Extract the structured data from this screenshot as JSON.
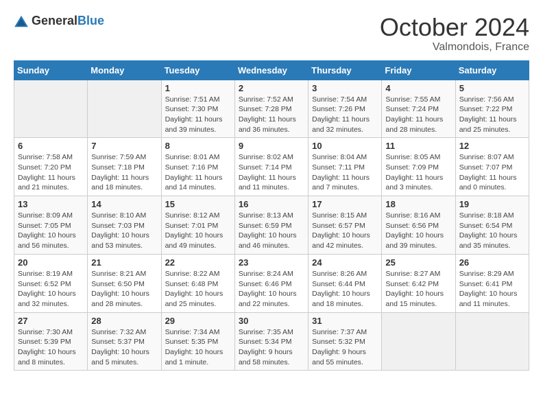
{
  "header": {
    "logo_general": "General",
    "logo_blue": "Blue",
    "month": "October 2024",
    "location": "Valmondois, France"
  },
  "days_of_week": [
    "Sunday",
    "Monday",
    "Tuesday",
    "Wednesday",
    "Thursday",
    "Friday",
    "Saturday"
  ],
  "weeks": [
    [
      {
        "day": "",
        "info": ""
      },
      {
        "day": "",
        "info": ""
      },
      {
        "day": "1",
        "info": "Sunrise: 7:51 AM\nSunset: 7:30 PM\nDaylight: 11 hours and 39 minutes."
      },
      {
        "day": "2",
        "info": "Sunrise: 7:52 AM\nSunset: 7:28 PM\nDaylight: 11 hours and 36 minutes."
      },
      {
        "day": "3",
        "info": "Sunrise: 7:54 AM\nSunset: 7:26 PM\nDaylight: 11 hours and 32 minutes."
      },
      {
        "day": "4",
        "info": "Sunrise: 7:55 AM\nSunset: 7:24 PM\nDaylight: 11 hours and 28 minutes."
      },
      {
        "day": "5",
        "info": "Sunrise: 7:56 AM\nSunset: 7:22 PM\nDaylight: 11 hours and 25 minutes."
      }
    ],
    [
      {
        "day": "6",
        "info": "Sunrise: 7:58 AM\nSunset: 7:20 PM\nDaylight: 11 hours and 21 minutes."
      },
      {
        "day": "7",
        "info": "Sunrise: 7:59 AM\nSunset: 7:18 PM\nDaylight: 11 hours and 18 minutes."
      },
      {
        "day": "8",
        "info": "Sunrise: 8:01 AM\nSunset: 7:16 PM\nDaylight: 11 hours and 14 minutes."
      },
      {
        "day": "9",
        "info": "Sunrise: 8:02 AM\nSunset: 7:14 PM\nDaylight: 11 hours and 11 minutes."
      },
      {
        "day": "10",
        "info": "Sunrise: 8:04 AM\nSunset: 7:11 PM\nDaylight: 11 hours and 7 minutes."
      },
      {
        "day": "11",
        "info": "Sunrise: 8:05 AM\nSunset: 7:09 PM\nDaylight: 11 hours and 3 minutes."
      },
      {
        "day": "12",
        "info": "Sunrise: 8:07 AM\nSunset: 7:07 PM\nDaylight: 11 hours and 0 minutes."
      }
    ],
    [
      {
        "day": "13",
        "info": "Sunrise: 8:09 AM\nSunset: 7:05 PM\nDaylight: 10 hours and 56 minutes."
      },
      {
        "day": "14",
        "info": "Sunrise: 8:10 AM\nSunset: 7:03 PM\nDaylight: 10 hours and 53 minutes."
      },
      {
        "day": "15",
        "info": "Sunrise: 8:12 AM\nSunset: 7:01 PM\nDaylight: 10 hours and 49 minutes."
      },
      {
        "day": "16",
        "info": "Sunrise: 8:13 AM\nSunset: 6:59 PM\nDaylight: 10 hours and 46 minutes."
      },
      {
        "day": "17",
        "info": "Sunrise: 8:15 AM\nSunset: 6:57 PM\nDaylight: 10 hours and 42 minutes."
      },
      {
        "day": "18",
        "info": "Sunrise: 8:16 AM\nSunset: 6:56 PM\nDaylight: 10 hours and 39 minutes."
      },
      {
        "day": "19",
        "info": "Sunrise: 8:18 AM\nSunset: 6:54 PM\nDaylight: 10 hours and 35 minutes."
      }
    ],
    [
      {
        "day": "20",
        "info": "Sunrise: 8:19 AM\nSunset: 6:52 PM\nDaylight: 10 hours and 32 minutes."
      },
      {
        "day": "21",
        "info": "Sunrise: 8:21 AM\nSunset: 6:50 PM\nDaylight: 10 hours and 28 minutes."
      },
      {
        "day": "22",
        "info": "Sunrise: 8:22 AM\nSunset: 6:48 PM\nDaylight: 10 hours and 25 minutes."
      },
      {
        "day": "23",
        "info": "Sunrise: 8:24 AM\nSunset: 6:46 PM\nDaylight: 10 hours and 22 minutes."
      },
      {
        "day": "24",
        "info": "Sunrise: 8:26 AM\nSunset: 6:44 PM\nDaylight: 10 hours and 18 minutes."
      },
      {
        "day": "25",
        "info": "Sunrise: 8:27 AM\nSunset: 6:42 PM\nDaylight: 10 hours and 15 minutes."
      },
      {
        "day": "26",
        "info": "Sunrise: 8:29 AM\nSunset: 6:41 PM\nDaylight: 10 hours and 11 minutes."
      }
    ],
    [
      {
        "day": "27",
        "info": "Sunrise: 7:30 AM\nSunset: 5:39 PM\nDaylight: 10 hours and 8 minutes."
      },
      {
        "day": "28",
        "info": "Sunrise: 7:32 AM\nSunset: 5:37 PM\nDaylight: 10 hours and 5 minutes."
      },
      {
        "day": "29",
        "info": "Sunrise: 7:34 AM\nSunset: 5:35 PM\nDaylight: 10 hours and 1 minute."
      },
      {
        "day": "30",
        "info": "Sunrise: 7:35 AM\nSunset: 5:34 PM\nDaylight: 9 hours and 58 minutes."
      },
      {
        "day": "31",
        "info": "Sunrise: 7:37 AM\nSunset: 5:32 PM\nDaylight: 9 hours and 55 minutes."
      },
      {
        "day": "",
        "info": ""
      },
      {
        "day": "",
        "info": ""
      }
    ]
  ]
}
